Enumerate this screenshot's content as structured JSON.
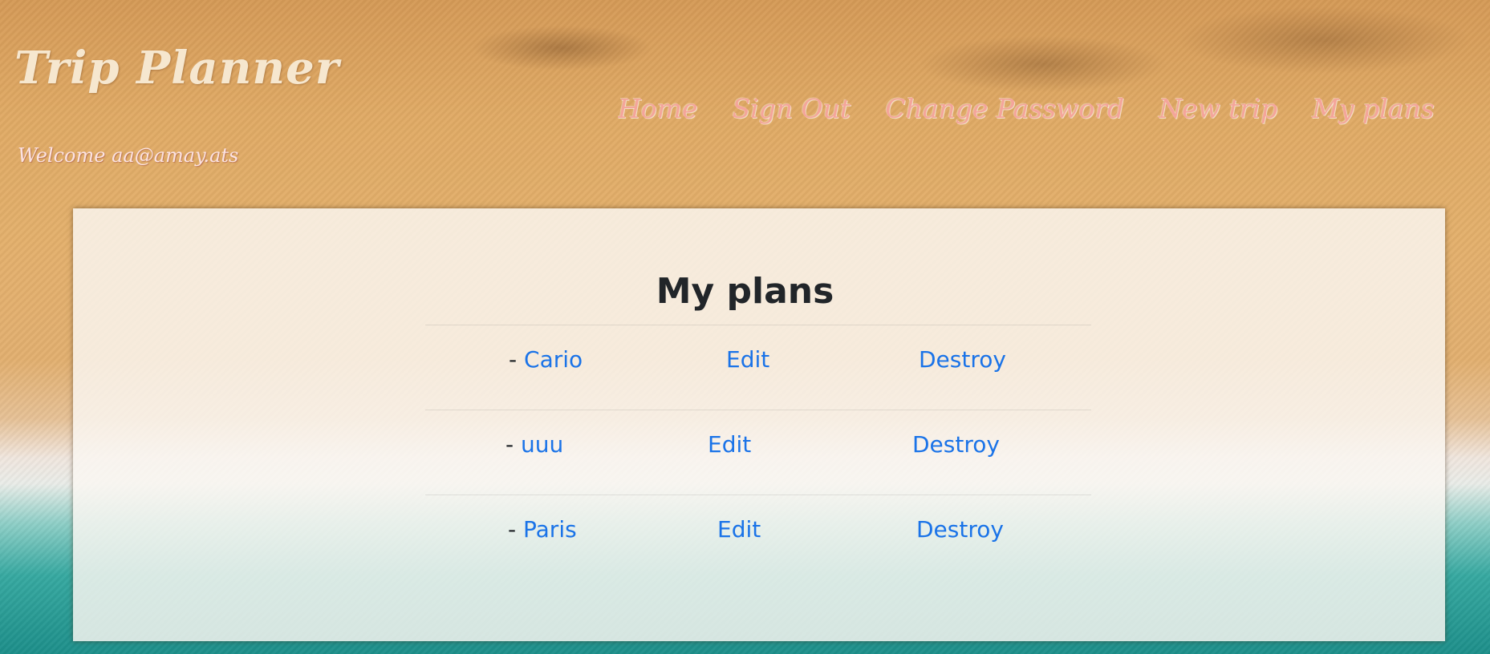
{
  "brand": {
    "title": "Trip Planner"
  },
  "welcome": {
    "text": "Welcome aa@amay.ats"
  },
  "nav": {
    "items": [
      {
        "label": "Home"
      },
      {
        "label": "Sign Out"
      },
      {
        "label": "Change Password"
      },
      {
        "label": "New trip"
      },
      {
        "label": "My plans"
      }
    ]
  },
  "main": {
    "title": "My plans",
    "plans": [
      {
        "prefix": "- ",
        "name": "Cario",
        "edit": "Edit",
        "destroy": "Destroy"
      },
      {
        "prefix": "- ",
        "name": "uuu",
        "edit": "Edit",
        "destroy": "Destroy"
      },
      {
        "prefix": "- ",
        "name": "Paris",
        "edit": "Edit",
        "destroy": "Destroy"
      }
    ]
  },
  "colors": {
    "link": "#1a73e8",
    "nav_link": "#f4a59b",
    "brand": "#f6e7cf",
    "heading": "#212529"
  }
}
